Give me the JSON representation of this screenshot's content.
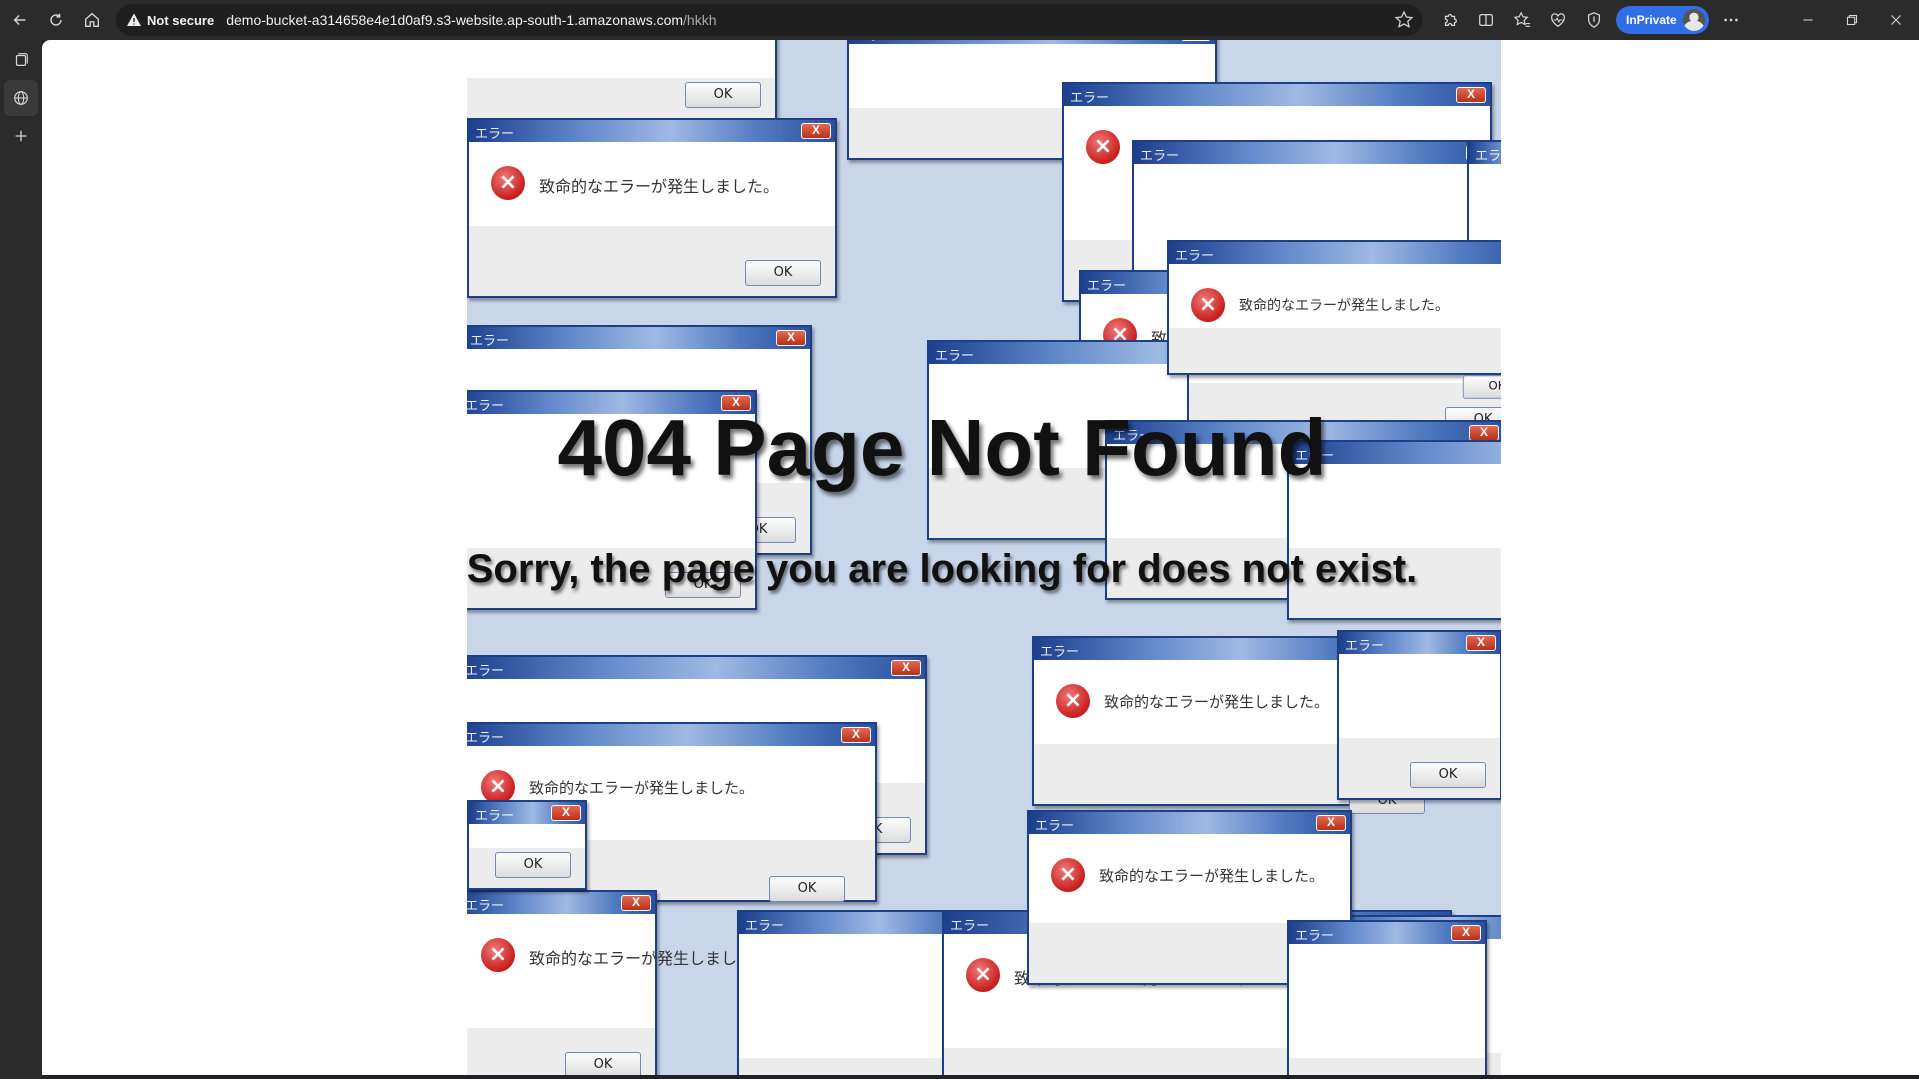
{
  "browser": {
    "security_label": "Not secure",
    "url_host": "demo-bucket-a314658e4e1d0af9.s3-website.ap-south-1.amazonaws.com",
    "url_path": "/hkkh",
    "inprivate_label": "InPrivate",
    "accent_color": "#2f6ee6"
  },
  "page": {
    "title": "404 Page Not Found",
    "message": "Sorry, the page you are looking for does not exist."
  },
  "background_dialogs": {
    "title": "エラー",
    "message": "致命的なエラーが発生しました。",
    "ok_label": "OK",
    "close_label": "X"
  }
}
